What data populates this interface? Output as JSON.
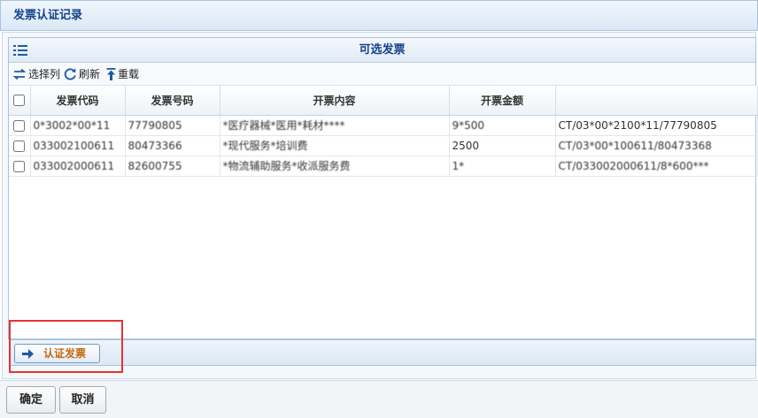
{
  "window": {
    "title": "发票认证记录"
  },
  "panel": {
    "title": "可选发票",
    "list_icon": "list-icon"
  },
  "toolbar": {
    "select_columns": {
      "label": "选择列",
      "icon": "columns-swap-icon"
    },
    "refresh": {
      "label": "刷新",
      "icon": "refresh-icon"
    },
    "reload": {
      "label": "重载",
      "icon": "reload-arrow-icon"
    }
  },
  "grid": {
    "columns": [
      "发票代码",
      "发票号码",
      "开票内容",
      "开票金额",
      ""
    ],
    "rows": [
      {
        "code": "0*3002*00*11",
        "number": "77790805",
        "content": "*医疗器械*医用*耗材****",
        "amount": "9*500",
        "ref": "CT/03*00*2100*11/77790805"
      },
      {
        "code": "033002100611",
        "number": "80473366",
        "content": "*现代服务*培训费",
        "amount": "2500",
        "ref": "CT/03*00*100611/80473368"
      },
      {
        "code": "033002000611",
        "number": "82600755",
        "content": "*物流辅助服务*收派服务费",
        "amount": "1*",
        "ref": "CT/033002000611/8*600***"
      }
    ]
  },
  "actions": {
    "verify_label": "认证发票",
    "verify_icon": "arrow-right-icon"
  },
  "footer": {
    "ok_label": "确定",
    "cancel_label": "取消"
  },
  "colors": {
    "title_blue": "#15428b",
    "accent_orange": "#c46a14",
    "highlight_red": "#e53333"
  }
}
